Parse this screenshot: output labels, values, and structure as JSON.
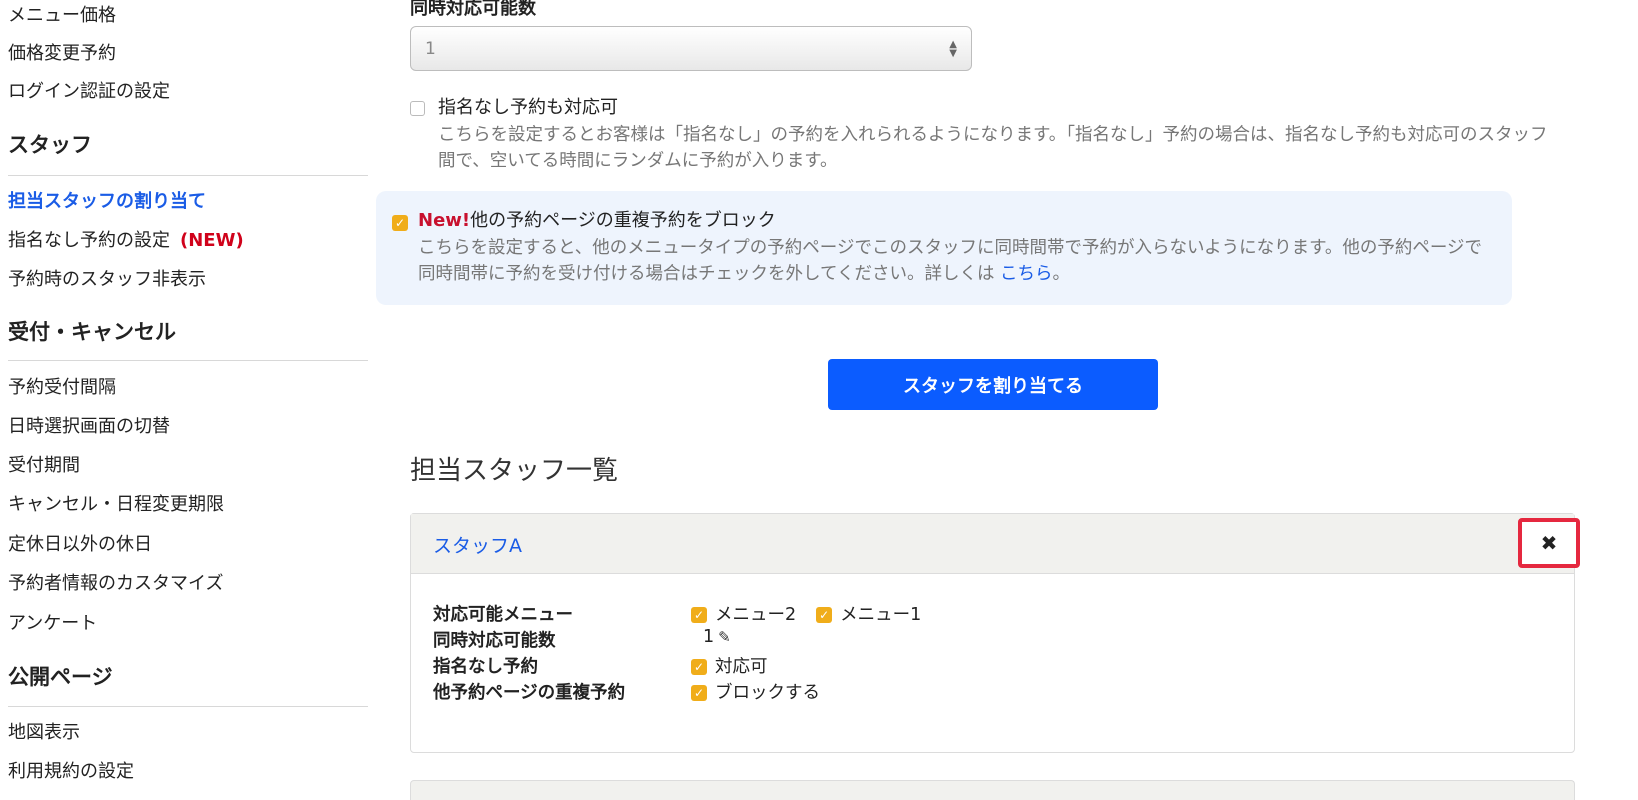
{
  "sidebar": {
    "items_top": [
      "メニュー価格",
      "価格変更予約",
      "ログイン認証の設定"
    ],
    "sections": [
      {
        "heading": "スタッフ",
        "items": [
          {
            "label": "担当スタッフの割り当て",
            "active": true
          },
          {
            "label": "指名なし予約の設定",
            "badge": "(NEW)"
          },
          {
            "label": "予約時のスタッフ非表示"
          }
        ]
      },
      {
        "heading": "受付・キャンセル",
        "items": [
          {
            "label": "予約受付間隔"
          },
          {
            "label": "日時選択画面の切替"
          },
          {
            "label": "受付期間"
          },
          {
            "label": "キャンセル・日程変更期限"
          },
          {
            "label": "定休日以外の休日"
          },
          {
            "label": "予約者情報のカスタマイズ"
          },
          {
            "label": "アンケート"
          }
        ]
      },
      {
        "heading": "公開ページ",
        "items": [
          {
            "label": "地図表示"
          },
          {
            "label": "利用規約の設定"
          }
        ]
      }
    ]
  },
  "form": {
    "capacity_label": "同時対応可能数",
    "capacity_value": "1",
    "no_nomination": {
      "checked": false,
      "title": "指名なし予約も対応可",
      "description": "こちらを設定するとお客様は「指名なし」の予約を入れられるようになります。「指名なし」予約の場合は、指名なし予約も対応可のスタッフ間で、空いてる時間にランダムに予約が入ります。"
    },
    "block_duplicate": {
      "checked": true,
      "new_tag": "New!",
      "title": "他の予約ページの重複予約をブロック",
      "description": "こちらを設定すると、他のメニュータイプの予約ページでこのスタッフに同時間帯で予約が入らないようになります。他の予約ページで同時間帯に予約を受け付ける場合はチェックを外してください。詳しくは",
      "link_text": "こちら",
      "suffix": "。"
    },
    "assign_button": "スタッフを割り当てる"
  },
  "staff_list": {
    "title": "担当スタッフ一覧",
    "staff": [
      {
        "name": "スタッフA",
        "rows": {
          "menus_label": "対応可能メニュー",
          "menus": [
            "メニュー2",
            "メニュー1"
          ],
          "capacity_label": "同時対応可能数",
          "capacity": "1",
          "nomination_label": "指名なし予約",
          "nomination": "対応可",
          "duplicate_label": "他予約ページの重複予約",
          "duplicate": "ブロックする"
        }
      }
    ]
  },
  "icons": {
    "checkbox_checked": "checkmark-icon",
    "close": "close-icon",
    "edit": "pencil-icon",
    "select": "select-arrows-icon"
  },
  "colors": {
    "accent_blue": "#0b5cff",
    "link_blue": "#1a5ce6",
    "new_red": "#d0021b",
    "checkbox_orange": "#f0ad1a",
    "highlight_red": "#e5283f",
    "panel_bg": "#eef4fd"
  }
}
